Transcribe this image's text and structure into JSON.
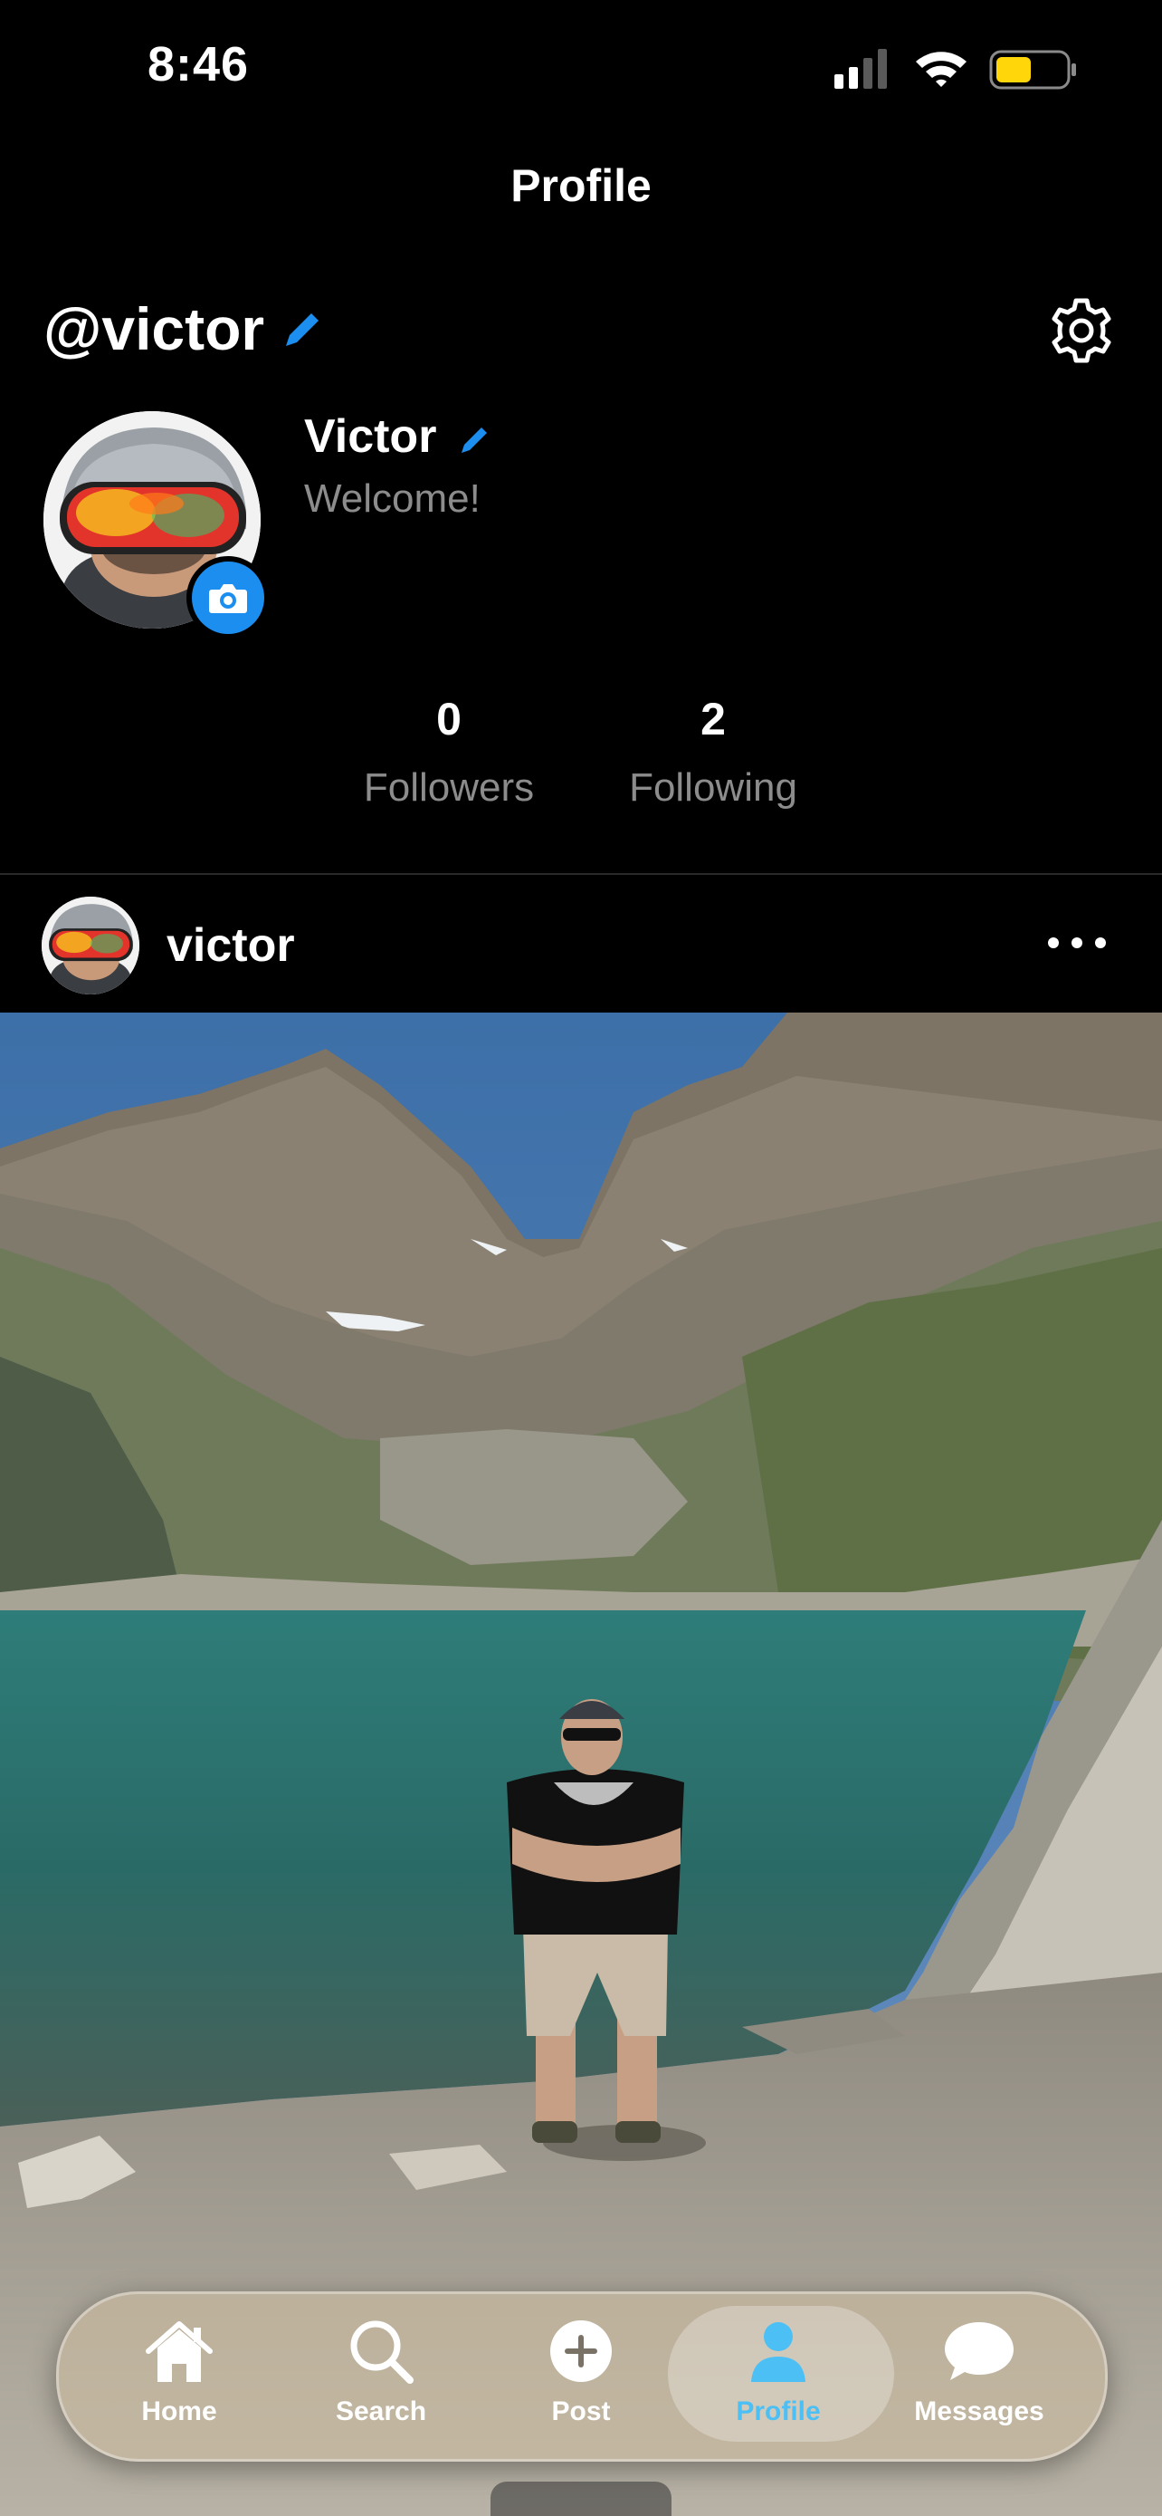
{
  "status_bar": {
    "time": "8:46"
  },
  "header": {
    "title": "Profile"
  },
  "profile": {
    "handle": "@victor",
    "display_name": "Victor",
    "bio": "Welcome!",
    "followers_count": "0",
    "followers_label": "Followers",
    "following_count": "2",
    "following_label": "Following"
  },
  "post": {
    "username": "victor"
  },
  "tab_bar": {
    "items": [
      {
        "label": "Home",
        "icon": "home-icon"
      },
      {
        "label": "Search",
        "icon": "search-icon"
      },
      {
        "label": "Post",
        "icon": "plus-circle-icon"
      },
      {
        "label": "Profile",
        "icon": "person-icon",
        "active": true
      },
      {
        "label": "Messages",
        "icon": "chat-bubble-icon"
      }
    ]
  },
  "colors": {
    "accent": "#1b8ef0",
    "active_tab": "#4cc0f5",
    "secondary_text": "#8c8c8c",
    "battery": "#ffd60a"
  }
}
